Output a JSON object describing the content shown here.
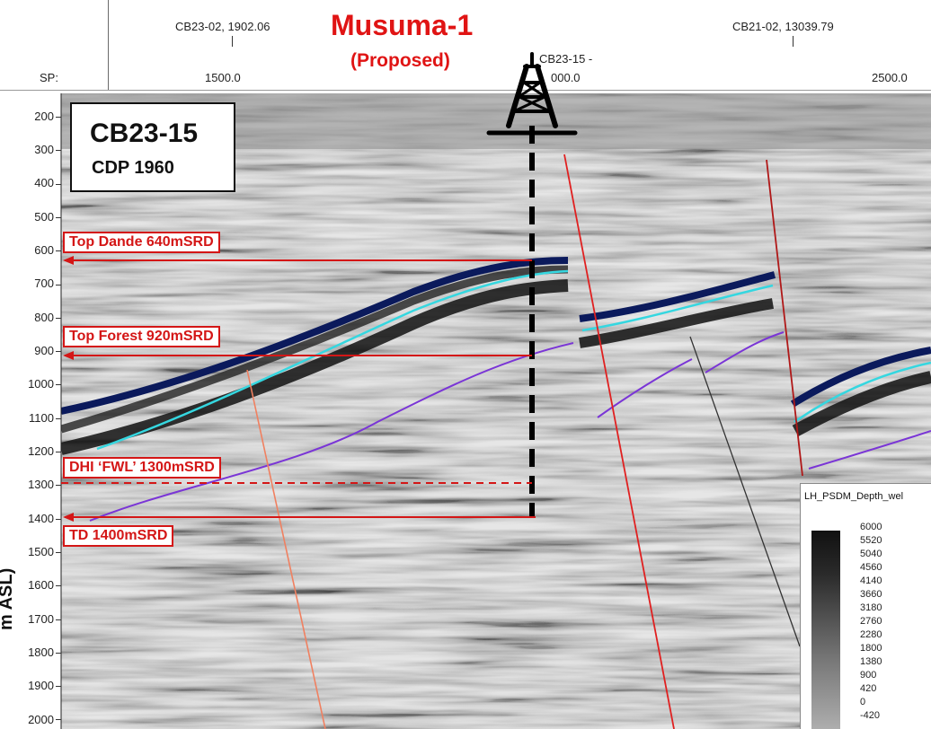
{
  "header": {
    "well_name": "Musuma-1",
    "well_status": "(Proposed)",
    "sp_label": "SP:",
    "sp_ticks": [
      "1500.0",
      "2500.0"
    ],
    "sp_partial_tick": "000.0",
    "well_ties": [
      {
        "label": "CB23-02, 1902.06"
      },
      {
        "label": "CB21-02, 13039.79"
      },
      {
        "label": "CB23-15 -"
      }
    ]
  },
  "line_box": {
    "line_name": "CB23-15",
    "cdp": "CDP 1960"
  },
  "depth_axis": {
    "label": "m ASL)",
    "ticks": [
      "200",
      "300",
      "400",
      "500",
      "600",
      "700",
      "800",
      "900",
      "1000",
      "1100",
      "1200",
      "1300",
      "1400",
      "1500",
      "1600",
      "1700",
      "1800",
      "1900",
      "2000"
    ]
  },
  "annotations": {
    "top_dande": "Top Dande  640mSRD",
    "top_forest": "Top Forest  920mSRD",
    "dhi_fwl": "DHI ‘FWL’  1300mSRD",
    "td": "TD  1400mSRD"
  },
  "colorbar": {
    "title": "LH_PSDM_Depth_wel",
    "ticks": [
      "6000",
      "5520",
      "5040",
      "4560",
      "4140",
      "3660",
      "3180",
      "2760",
      "2280",
      "1800",
      "1380",
      "900",
      "420",
      "0",
      "-420"
    ]
  },
  "colors": {
    "accent_red": "#d41616",
    "horizon_blue": "#0b1a5c",
    "horizon_cyan": "#35d7e0",
    "horizon_purple": "#7a35d6",
    "fault_red": "#e02020",
    "fault_orange": "#f08060"
  },
  "icons": {
    "well_rig": "drilling-rig-icon"
  }
}
